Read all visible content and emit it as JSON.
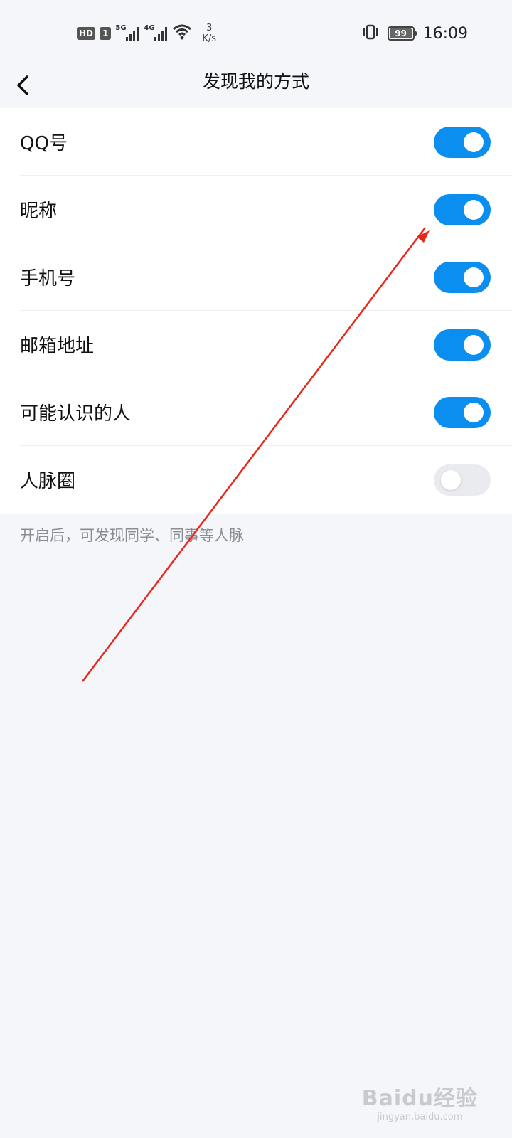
{
  "status_bar": {
    "hd": "HD",
    "sim": "1",
    "net1": "5G",
    "net2": "4G",
    "speed_value": "3",
    "speed_unit": "K/s",
    "battery": "99",
    "battery_level": 0.99,
    "time": "16:09"
  },
  "nav": {
    "title": "发现我的方式"
  },
  "items": [
    {
      "label": "QQ号",
      "enabled": true
    },
    {
      "label": "昵称",
      "enabled": true
    },
    {
      "label": "手机号",
      "enabled": true
    },
    {
      "label": "邮箱地址",
      "enabled": true
    },
    {
      "label": "可能认识的人",
      "enabled": true
    },
    {
      "label": "人脉圈",
      "enabled": false
    }
  ],
  "footnote": "开启后，可发现同学、同事等人脉",
  "colors": {
    "toggle_on": "#0a8ff0",
    "toggle_off": "#eaebef",
    "annotation_arrow": "#e8261c"
  },
  "watermark": {
    "brand": "Baidu经验",
    "url": "jingyan.baidu.com"
  }
}
